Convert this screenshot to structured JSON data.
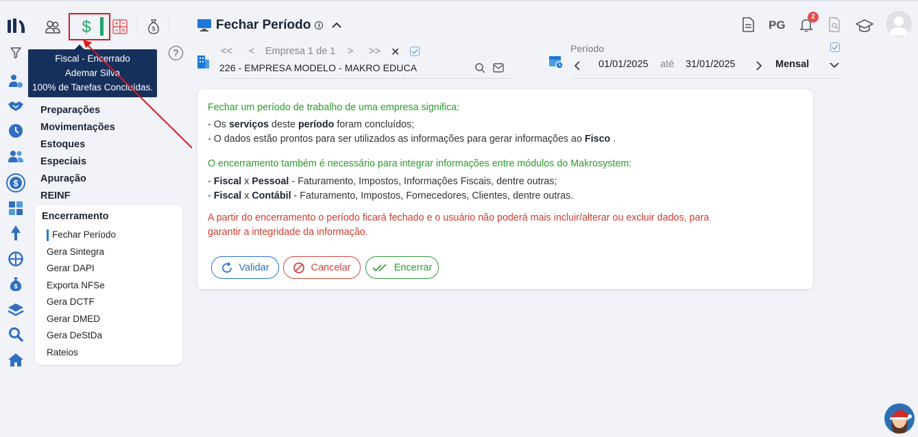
{
  "colors": {
    "accent_blue": "#1e78d8",
    "green": "#2a9c2a",
    "red": "#d33a2c",
    "navy": "#16305c",
    "highlight_red": "#e0171b"
  },
  "rail_icons": [
    "users-gear-icon",
    "handshake-icon",
    "clock-icon",
    "people-icon",
    "dollar-icon",
    "calculator-icon",
    "tree-icon",
    "globe-icon",
    "money-bag-icon",
    "layers-icon",
    "search-icon",
    "home-icon"
  ],
  "top_modules": [
    "users-icon",
    "dollar-icon",
    "calculator-icon",
    "money-bag-icon"
  ],
  "tooltip": {
    "line1": "Fiscal - Encerrado",
    "line2": "Ademar Silva",
    "line3": "100% de Tarefas Concluídas."
  },
  "menu": {
    "items": [
      "Preparações",
      "Movimentações",
      "Estoques",
      "Especiais",
      "Apuração",
      "REINF"
    ],
    "submenu_title": "Encerramento",
    "subitems": [
      "Fechar Período",
      "Gera Sintegra",
      "Gerar DAPI",
      "Exporta NFSe",
      "Gera DCTF",
      "Gerar DMED",
      "Gera DeStDa",
      "Rateios"
    ]
  },
  "header": {
    "title": "Fechar Período",
    "pg_label": "PG",
    "notification_count": "2"
  },
  "empresa": {
    "nav_label": "Empresa 1 de 1",
    "name": "226 - EMPRESA MODELO - MAKRO EDUCA"
  },
  "periodo": {
    "label": "Período",
    "start": "01/01/2025",
    "sep": "até",
    "end": "31/01/2025",
    "mode": "Mensal"
  },
  "content": {
    "heading1": "Fechar um período de trabalho de uma empresa significa:",
    "l1_a": "- Os ",
    "l1_b": "serviços",
    "l1_c": " deste ",
    "l1_d": "período",
    "l1_e": " foram concluídos;",
    "l2_a": "- O dados estão prontos para ser utilizados as informações para gerar informações ao ",
    "l2_b": "Fisco",
    "l2_c": " .",
    "heading2": "O encerramento também é necessário para integrar informações entre módulos do Makrosystem:",
    "l3_a": "- ",
    "l3_b": "Fiscal",
    "l3_c": " x ",
    "l3_d": "Pessoal",
    "l3_e": " - Faturamento, Impostos, Informações Fiscais, dentre outras;",
    "l4_a": "- ",
    "l4_b": "Fiscal",
    "l4_c": " x ",
    "l4_d": "Contábil",
    "l4_e": " - Faturamento, Impostos, Fornecedores, Clientes, dentre outras.",
    "warning_1": "A partir do encerramento o período ficará fechado e o usuário não poderá mais incluir/alterar ou excluir dados, para",
    "warning_2": "garantir a integridade da informação."
  },
  "buttons": {
    "validar": "Validar",
    "cancelar": "Cancelar",
    "encerrar": "Encerrar"
  }
}
